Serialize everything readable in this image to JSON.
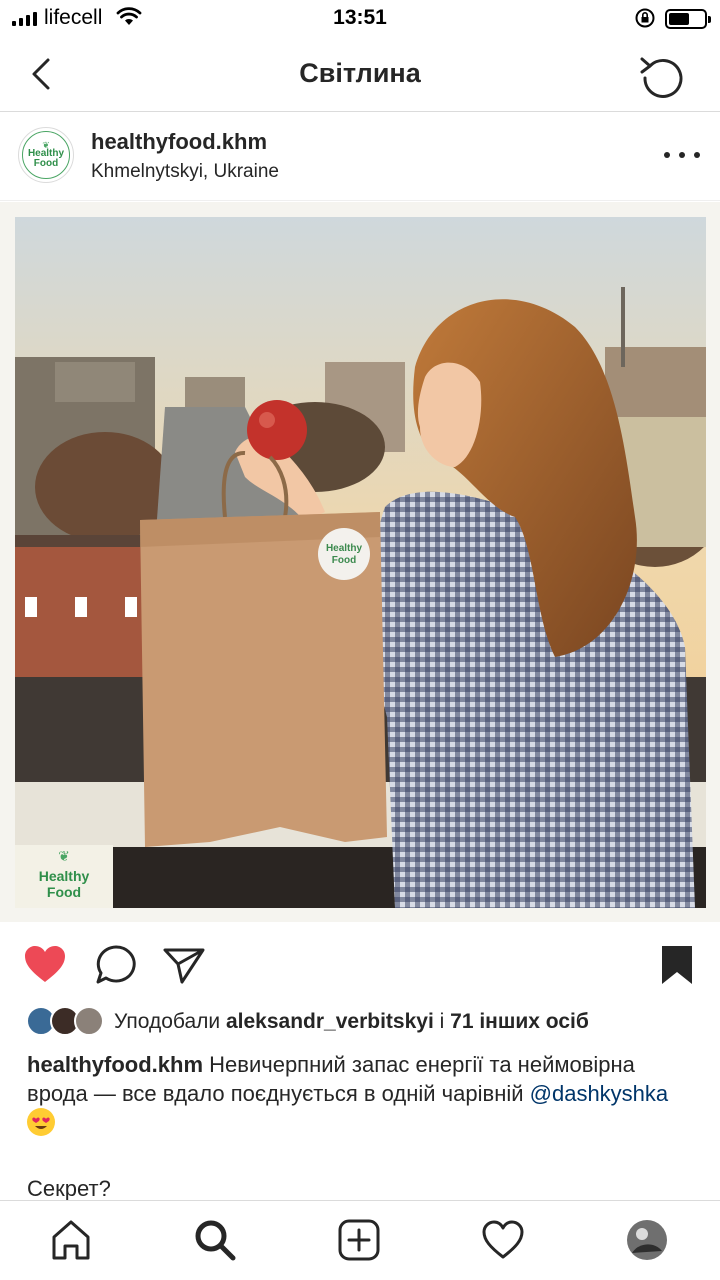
{
  "status_bar": {
    "carrier": "lifecell",
    "time": "13:51",
    "icons": [
      "signal-icon",
      "wifi-icon",
      "rotation-lock-icon",
      "battery-icon"
    ]
  },
  "nav": {
    "title": "Світлина",
    "back_icon": "chevron-left-icon",
    "refresh_icon": "refresh-icon"
  },
  "post": {
    "username": "healthyfood.khm",
    "location": "Khmelnytskyi, Ukraine",
    "avatar_text": "Healthy Food",
    "photo_logo_text": "Healthy Food",
    "bag_sticker_text": "Healthy Food"
  },
  "actions": {
    "like_icon": "heart-filled-icon",
    "comment_icon": "comment-icon",
    "share_icon": "send-icon",
    "save_icon": "bookmark-filled-icon",
    "like_color": "#ed4956"
  },
  "likes": {
    "prefix": "Уподобали",
    "user": "aleksandr_verbitskyi",
    "joiner": "і",
    "others": "71 інших осіб"
  },
  "caption": {
    "username": "healthyfood.khm",
    "text": "Невичерпний запас енергії та неймовірна врода — все вдало поєднується в одній чарівній",
    "mention": "@dashkyshka",
    "emoji": "heart-eyes-emoji",
    "second_line": "Секрет?"
  },
  "tabbar": {
    "items": [
      "home-icon",
      "search-icon",
      "new-post-icon",
      "activity-icon",
      "profile-avatar"
    ]
  }
}
